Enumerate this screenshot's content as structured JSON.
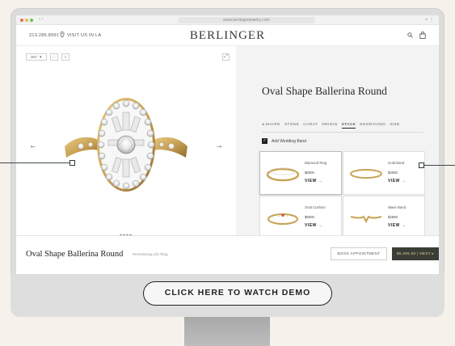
{
  "browser": {
    "url": "www.berlingerjewelry.com"
  },
  "header": {
    "phone": "213.286.8991",
    "visit_label": "VISIT US IN LA",
    "brand": "BERLINGER"
  },
  "gallery": {
    "tool_1": "360° ▼",
    "tool_2": "♡",
    "tool_3": "⇪",
    "expand": "⤢",
    "prev": "←",
    "next": "→",
    "page_count": 4,
    "active_page": 1
  },
  "product": {
    "title": "Oval Shape Ballerina Round",
    "steps": [
      "◂ SHAPE",
      "STONE",
      "CARAT",
      "ORIGIN",
      "STACK",
      "ENGRAVING",
      "SIZE"
    ],
    "active_step": "STACK",
    "add_band_label": "Add Wedding Band",
    "cards": [
      {
        "name": "Diamond Ring",
        "price": "$6000",
        "view": "VIEW →",
        "selected": true
      },
      {
        "name": "Gold Band",
        "price": "$2000",
        "view": "VIEW →",
        "selected": false
      },
      {
        "name": "Oval Cushion",
        "price": "$5000",
        "view": "VIEW →",
        "selected": false
      },
      {
        "name": "Wave Band",
        "price": "$2500",
        "view": "VIEW →",
        "selected": false
      }
    ]
  },
  "bottom_bar": {
    "title": "Oval Shape Ballerina Round",
    "subtitle": "Reminiscing Life Ring",
    "appointment_label": "BOOK APPOINTMENT",
    "cart_label": "$5,495.00  |  NEXT ▸"
  },
  "cta": {
    "label": "CLICK HERE TO WATCH DEMO"
  },
  "colors": {
    "page_bg": "#f6f1ea",
    "gold": "#c9a253",
    "cart_bg": "#3b3e36"
  }
}
